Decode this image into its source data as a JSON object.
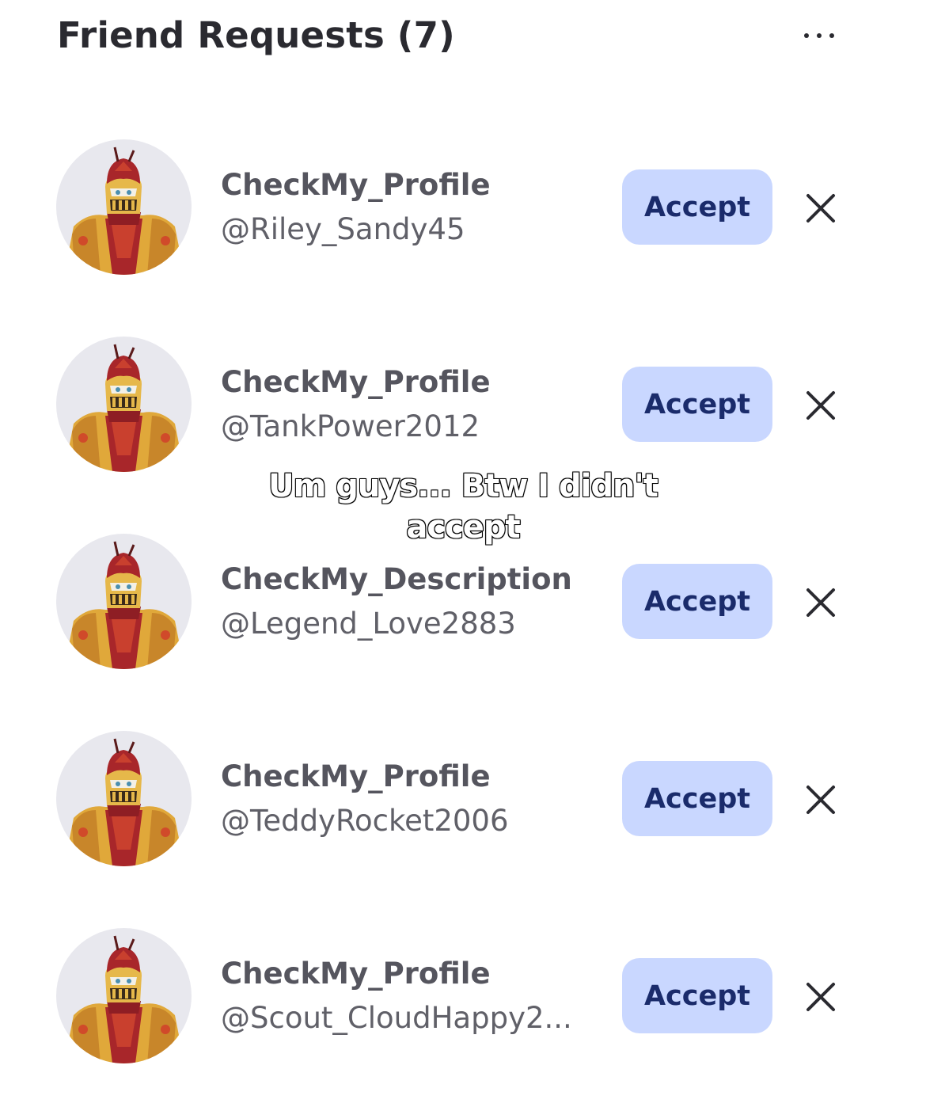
{
  "header": {
    "title": "Friend Requests (7)",
    "more_icon": "more-horizontal-icon"
  },
  "requests": [
    {
      "display_name": "CheckMy_Profile",
      "username": "@Riley_Sandy45",
      "accept_label": "Accept",
      "decline_icon": "close-icon"
    },
    {
      "display_name": "CheckMy_Profile",
      "username": "@TankPower2012",
      "accept_label": "Accept",
      "decline_icon": "close-icon"
    },
    {
      "display_name": "CheckMy_Description",
      "username": "@Legend_Love2883",
      "accept_label": "Accept",
      "decline_icon": "close-icon"
    },
    {
      "display_name": "CheckMy_Profile",
      "username": "@TeddyRocket2006",
      "accept_label": "Accept",
      "decline_icon": "close-icon"
    },
    {
      "display_name": "CheckMy_Profile",
      "username": "@Scout_CloudHappy2...",
      "accept_label": "Accept",
      "decline_icon": "close-icon"
    }
  ],
  "overlay": {
    "caption_line1": "Um guys... Btw I didn't",
    "caption_line2": "accept"
  },
  "colors": {
    "accept_bg": "#c9d7ff",
    "accept_text": "#1a2b6b",
    "avatar_bg": "#e8e8ee",
    "title_text": "#2a2a30"
  }
}
